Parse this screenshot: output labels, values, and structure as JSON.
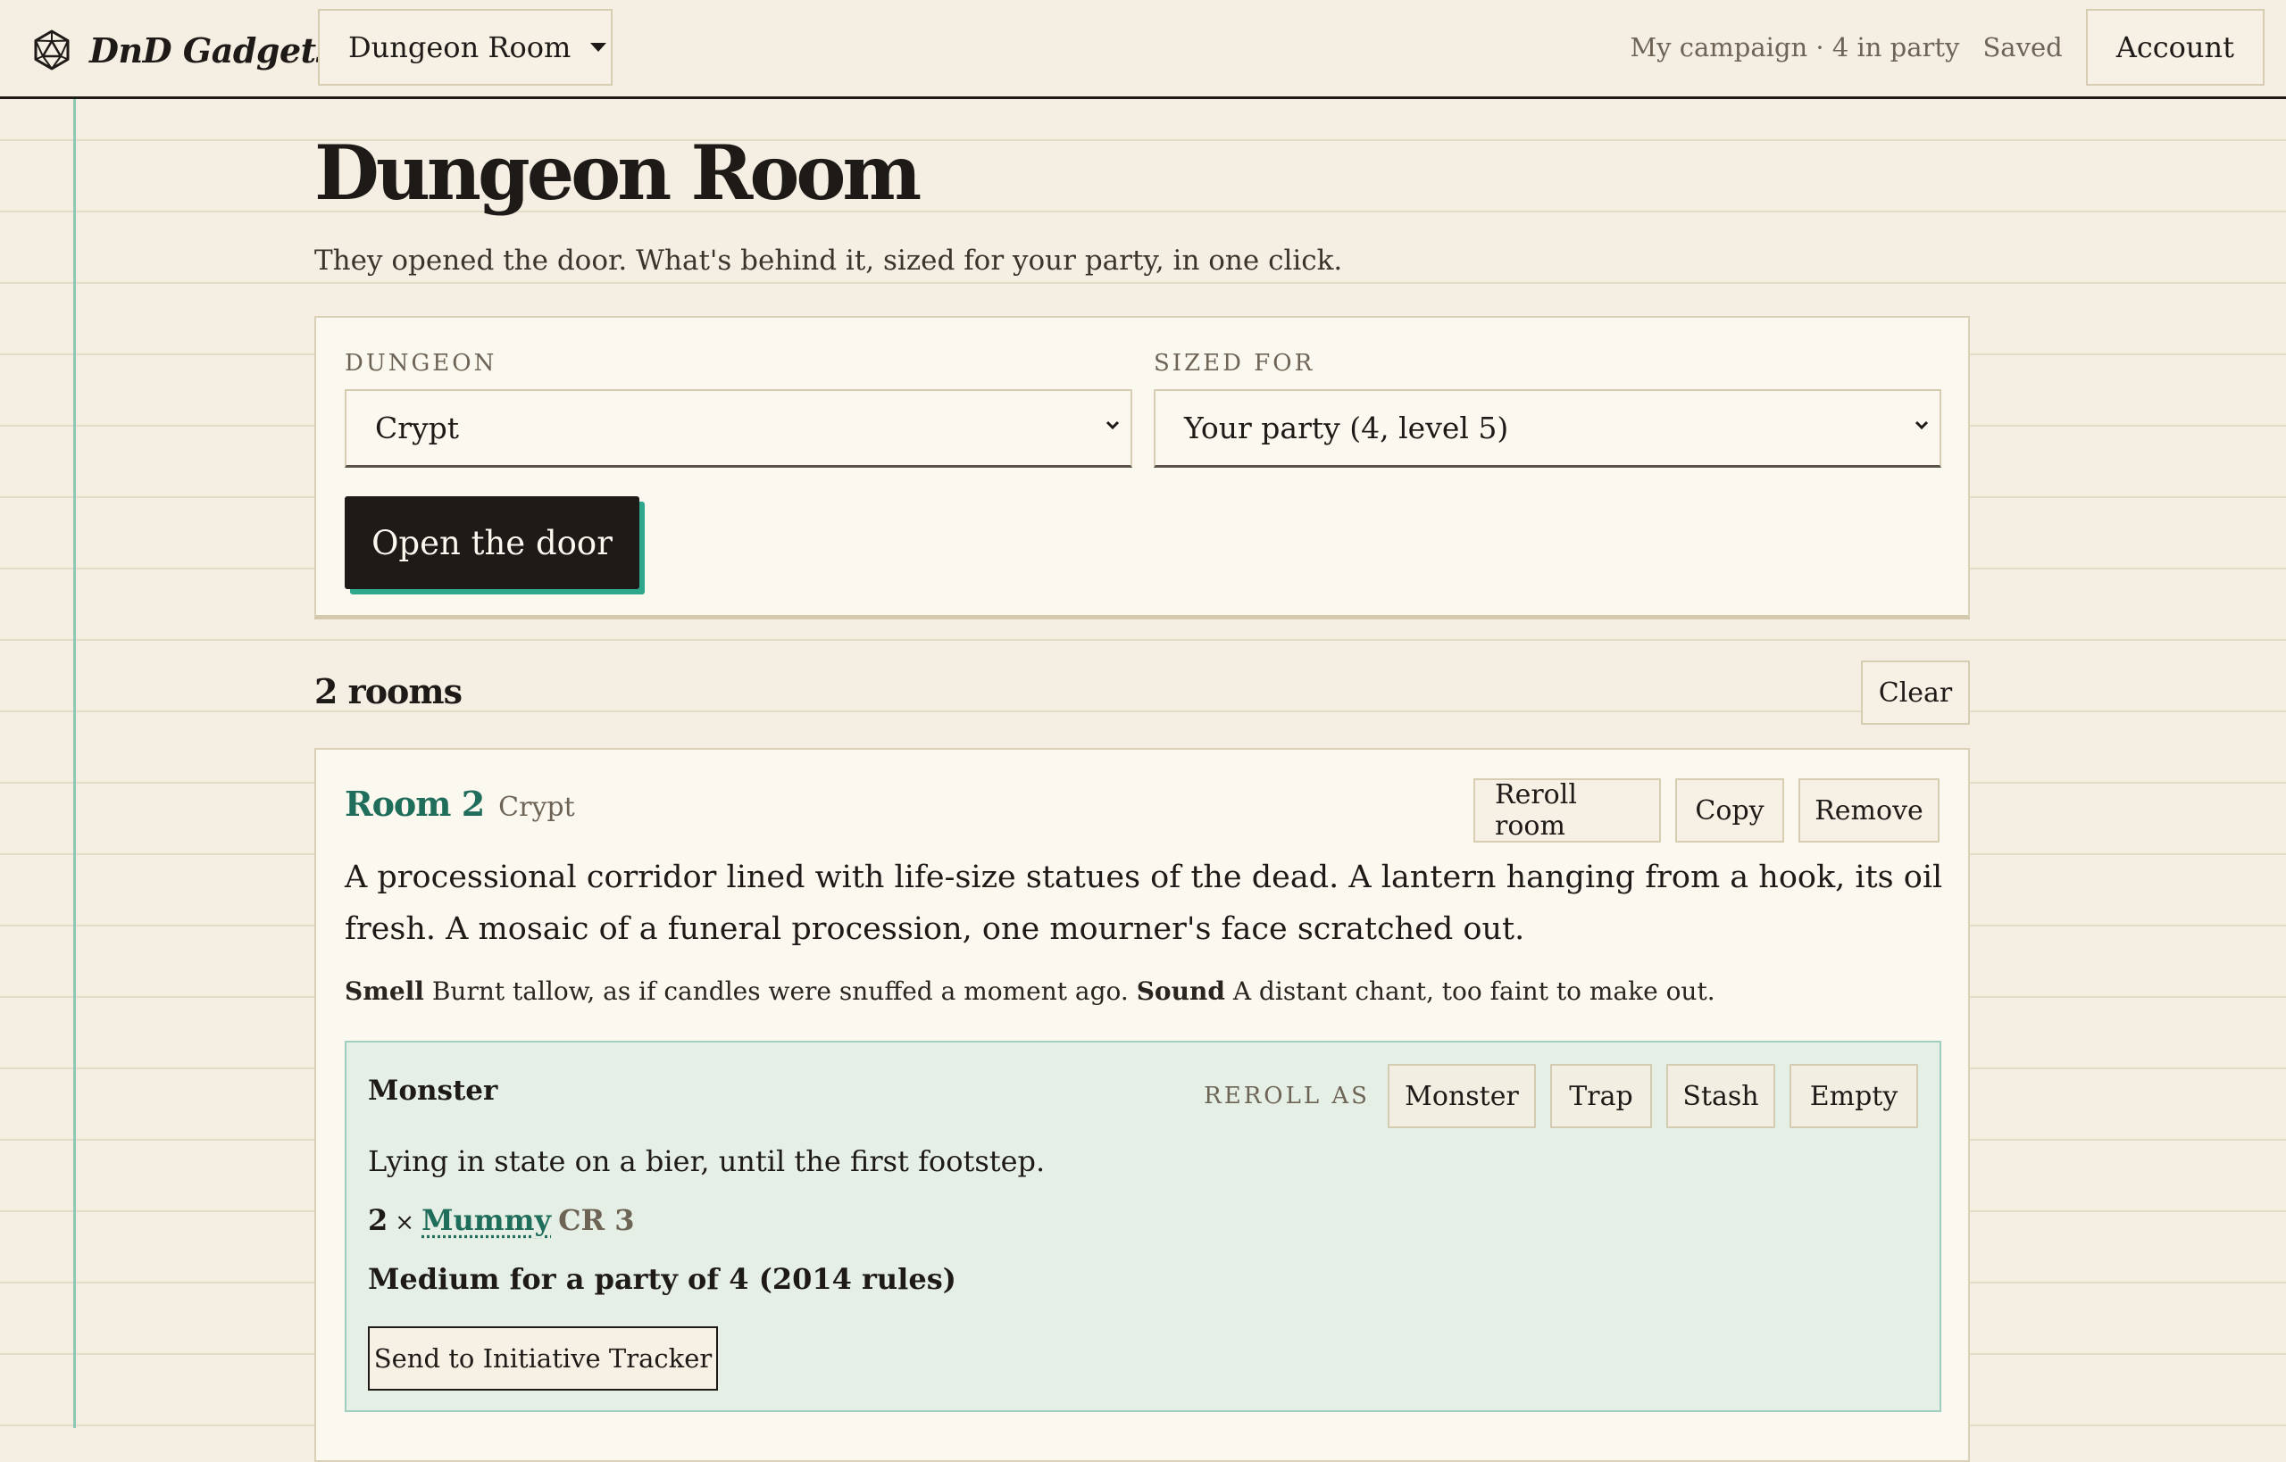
{
  "header": {
    "brand": "DnD Gadgets",
    "tool_picker": "Dungeon Room",
    "campaign_status": "My campaign · 4 in party",
    "save_status": "Saved",
    "account_label": "Account"
  },
  "page": {
    "title": "Dungeon Room",
    "subtitle": "They opened the door. What's behind it, sized for your party, in one click."
  },
  "form": {
    "dungeon_label": "DUNGEON",
    "dungeon_value": "Crypt",
    "sized_for_label": "SIZED FOR",
    "sized_for_value": "Your party (4, level 5)",
    "open_button": "Open the door"
  },
  "rooms": {
    "count_label": "2 rooms",
    "clear_label": "Clear"
  },
  "room": {
    "name": "Room 2",
    "type": "Crypt",
    "actions": {
      "reroll": "Reroll room",
      "copy": "Copy",
      "remove": "Remove"
    },
    "description": "A processional corridor lined with life-size statues of the dead. A lantern hanging from a hook, its oil fresh. A mosaic of a funeral procession, one mourner's face scratched out.",
    "smell_label": "Smell",
    "smell_text": "Burnt tallow, as if candles were snuffed a moment ago.",
    "sound_label": "Sound",
    "sound_text": "A distant chant, too faint to make out."
  },
  "encounter": {
    "kind": "Monster",
    "reroll_label": "REROLL AS",
    "reroll_options": [
      "Monster",
      "Trap",
      "Stash",
      "Empty"
    ],
    "flavor": "Lying in state on a bier, until the first footstep.",
    "count": "2",
    "times": "×",
    "monster_name": "Mummy",
    "cr": "CR 3",
    "difficulty": "Medium for a party of 4 (2014 rules)",
    "send_button": "Send to Initiative Tracker"
  },
  "colors": {
    "accent": "#1f6d5b",
    "button_shadow": "#2ea88d",
    "encounter_bg": "#e5efe5",
    "paper": "#f4efe2"
  },
  "icons": {
    "brand": "d20-icon",
    "dropdown": "chevron-down-icon"
  }
}
